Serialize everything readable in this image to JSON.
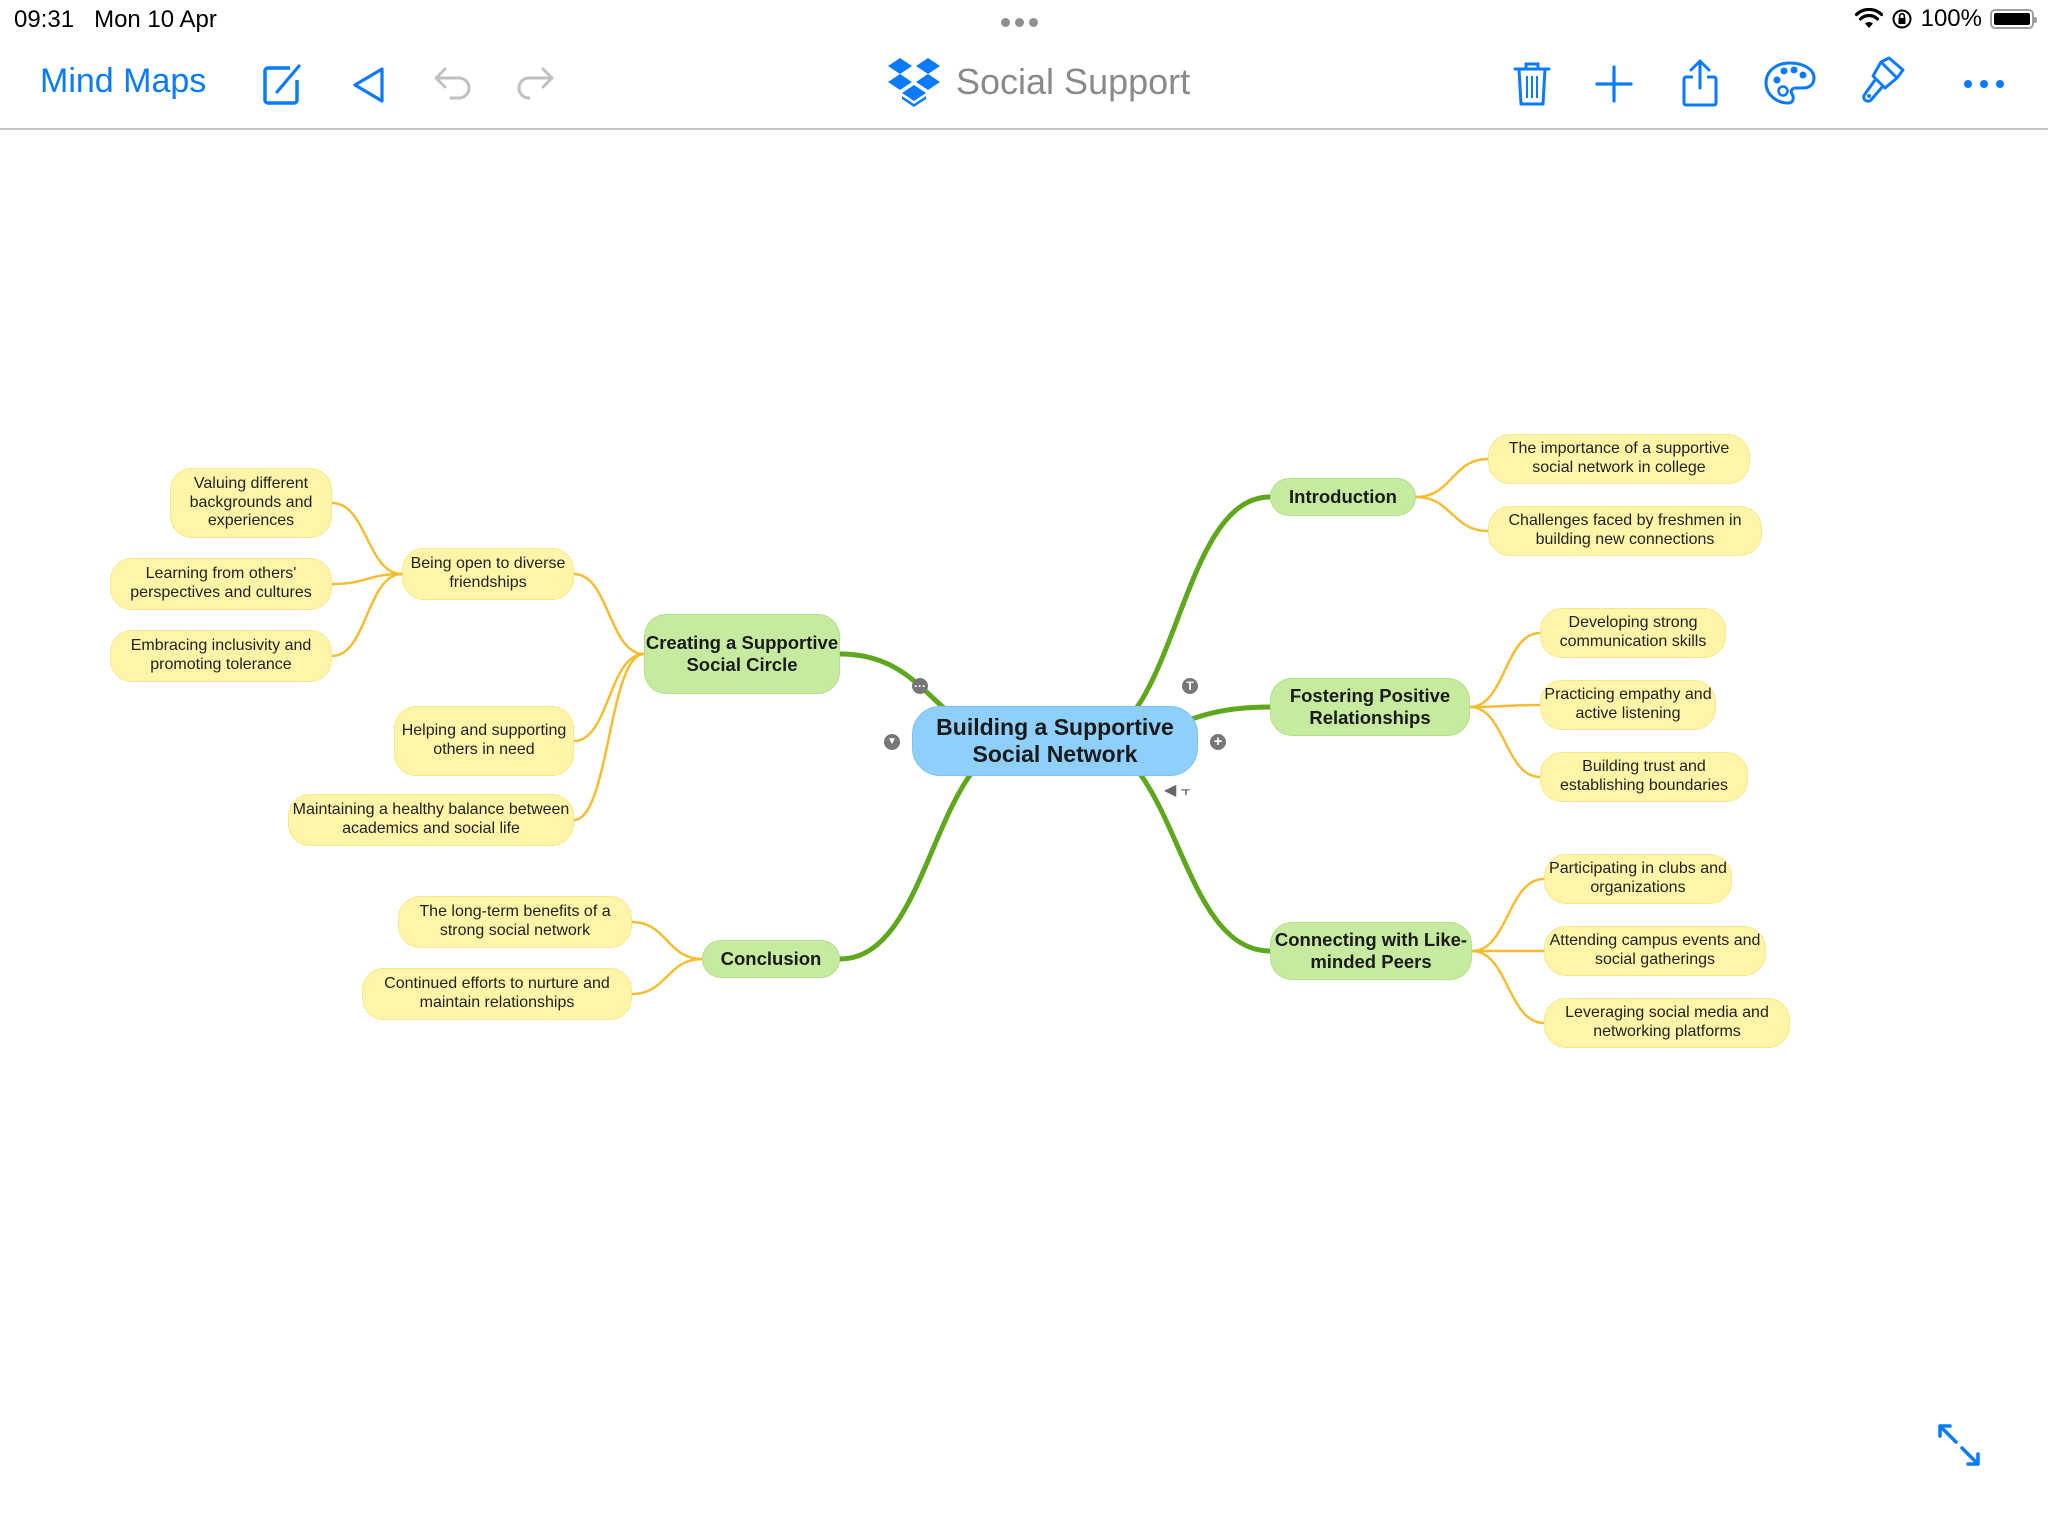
{
  "status_bar": {
    "time": "09:31",
    "date": "Mon 10 Apr",
    "battery": "100%",
    "battery_level": 1.0
  },
  "toolbar": {
    "back_label": "Mind Maps",
    "title": "Social Support",
    "left_icons": [
      "edit-icon",
      "play-triangle-icon",
      "undo-icon",
      "redo-icon"
    ],
    "right_icons": [
      "trash-icon",
      "plus-icon",
      "share-icon",
      "palette-icon",
      "paintbrush-icon",
      "more-icon"
    ],
    "accent_color": "#0a7aff",
    "disabled_color": "#c0c0c0"
  },
  "mindmap": {
    "colors": {
      "root_fill": "#8ecffb",
      "main_fill": "#c6eba0",
      "leaf_fill": "#fff5a9",
      "main_link": "#5fa81e",
      "leaf_link": "#f5be32"
    },
    "root": {
      "text": "Building a Supportive Social Network"
    },
    "branches": [
      {
        "text": "Introduction",
        "children": [
          {
            "text": "The importance of a supportive social network in college"
          },
          {
            "text": "Challenges faced by freshmen in building new connections"
          }
        ]
      },
      {
        "text": "Fostering Positive Relationships",
        "children": [
          {
            "text": "Developing strong communication skills"
          },
          {
            "text": "Practicing empathy and active listening"
          },
          {
            "text": "Building trust and establishing boundaries"
          }
        ]
      },
      {
        "text": "Connecting with Like-minded Peers",
        "children": [
          {
            "text": "Participating in clubs and organizations"
          },
          {
            "text": "Attending campus events and social gatherings"
          },
          {
            "text": "Leveraging social media and networking platforms"
          }
        ]
      },
      {
        "text": "Conclusion",
        "children": [
          {
            "text": "The long-term benefits of a strong social network"
          },
          {
            "text": "Continued efforts to nurture and maintain relationships"
          }
        ]
      },
      {
        "text": "Creating a Supportive Social Circle",
        "children": [
          {
            "text": "Being open to diverse friendships",
            "children": [
              {
                "text": "Valuing different backgrounds and experiences"
              },
              {
                "text": "Learning from others' perspectives and cultures"
              },
              {
                "text": "Embracing inclusivity and promoting tolerance"
              }
            ]
          },
          {
            "text": "Helping and supporting others in need"
          },
          {
            "text": "Maintaining a healthy balance between academics and social life"
          }
        ]
      }
    ],
    "node_controls": [
      "more-handle-icon",
      "text-handle-icon",
      "collapse-handle-icon",
      "add-child-icon",
      "callout-icon"
    ]
  },
  "expand_icon": "expand-arrows-icon"
}
